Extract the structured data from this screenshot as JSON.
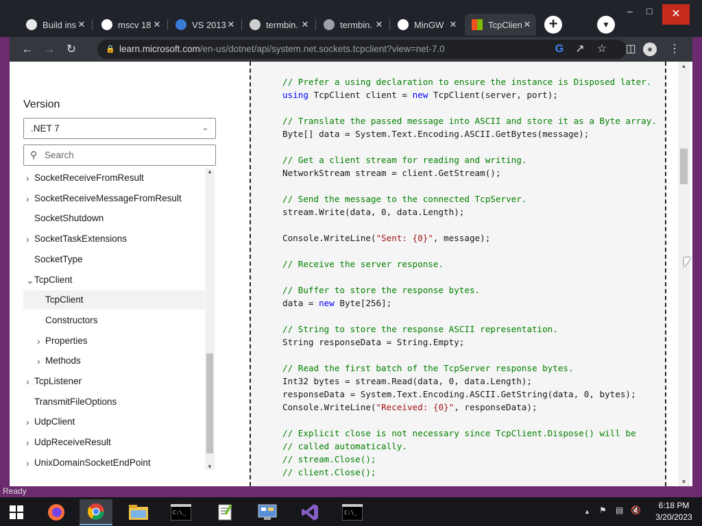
{
  "browser": {
    "tabs": [
      {
        "title": "Build ins",
        "icon": "github-icon"
      },
      {
        "title": "mscv 18",
        "icon": "google-icon"
      },
      {
        "title": "VS 2013",
        "icon": "visual-studio-icon"
      },
      {
        "title": "termbin.",
        "icon": "document-icon"
      },
      {
        "title": "termbin.",
        "icon": "globe-icon"
      },
      {
        "title": "MinGW",
        "icon": "google-icon"
      },
      {
        "title": "TcpClien",
        "icon": "microsoft-icon",
        "active": true
      }
    ],
    "url_host": "learn.microsoft.com",
    "url_path": "/en-us/dotnet/api/system.net.sockets.tcpclient?view=net-7.0"
  },
  "sidebar": {
    "version_label": "Version",
    "version_value": ".NET 7",
    "search_placeholder": "Search",
    "toc": [
      {
        "label": "SocketReceiveFromResult",
        "expandable": true,
        "level": 0
      },
      {
        "label": "SocketReceiveMessageFromResult",
        "expandable": true,
        "level": 0
      },
      {
        "label": "SocketShutdown",
        "expandable": false,
        "level": 0
      },
      {
        "label": "SocketTaskExtensions",
        "expandable": true,
        "level": 0
      },
      {
        "label": "SocketType",
        "expandable": false,
        "level": 0
      },
      {
        "label": "TcpClient",
        "expandable": true,
        "expanded": true,
        "level": 0
      },
      {
        "label": "TcpClient",
        "expandable": false,
        "level": 1,
        "selected": true
      },
      {
        "label": "Constructors",
        "expandable": false,
        "level": 1
      },
      {
        "label": "Properties",
        "expandable": true,
        "level": 1
      },
      {
        "label": "Methods",
        "expandable": true,
        "level": 1
      },
      {
        "label": "TcpListener",
        "expandable": true,
        "level": 0
      },
      {
        "label": "TransmitFileOptions",
        "expandable": false,
        "level": 0
      },
      {
        "label": "UdpClient",
        "expandable": true,
        "level": 0
      },
      {
        "label": "UdpReceiveResult",
        "expandable": true,
        "level": 0
      },
      {
        "label": "UnixDomainSocketEndPoint",
        "expandable": true,
        "level": 0
      }
    ]
  },
  "code": {
    "lines": [
      [
        [
          "c",
          "// Prefer a using declaration to ensure the instance is Disposed later."
        ]
      ],
      [
        [
          "k",
          "using"
        ],
        [
          "t",
          " TcpClient client = "
        ],
        [
          "k",
          "new"
        ],
        [
          "t",
          " TcpClient(server, port);"
        ]
      ],
      [],
      [
        [
          "c",
          "// Translate the passed message into ASCII and store it as a Byte array."
        ]
      ],
      [
        [
          "t",
          "Byte[] data = System.Text.Encoding.ASCII.GetBytes(message);"
        ]
      ],
      [],
      [
        [
          "c",
          "// Get a client stream for reading and writing."
        ]
      ],
      [
        [
          "t",
          "NetworkStream stream = client.GetStream();"
        ]
      ],
      [],
      [
        [
          "c",
          "// Send the message to the connected TcpServer."
        ]
      ],
      [
        [
          "t",
          "stream.Write(data, 0, data.Length);"
        ]
      ],
      [],
      [
        [
          "t",
          "Console.WriteLine("
        ],
        [
          "s",
          "\"Sent: {0}\""
        ],
        [
          "t",
          ", message);"
        ]
      ],
      [],
      [
        [
          "c",
          "// Receive the server response."
        ]
      ],
      [],
      [
        [
          "c",
          "// Buffer to store the response bytes."
        ]
      ],
      [
        [
          "t",
          "data = "
        ],
        [
          "k",
          "new"
        ],
        [
          "t",
          " Byte[256];"
        ]
      ],
      [],
      [
        [
          "c",
          "// String to store the response ASCII representation."
        ]
      ],
      [
        [
          "t",
          "String responseData = String.Empty;"
        ]
      ],
      [],
      [
        [
          "c",
          "// Read the first batch of the TcpServer response bytes."
        ]
      ],
      [
        [
          "t",
          "Int32 bytes = stream.Read(data, 0, data.Length);"
        ]
      ],
      [
        [
          "t",
          "responseData = System.Text.Encoding.ASCII.GetString(data, 0, bytes);"
        ]
      ],
      [
        [
          "t",
          "Console.WriteLine("
        ],
        [
          "s",
          "\"Received: {0}\""
        ],
        [
          "t",
          ", responseData);"
        ]
      ],
      [],
      [
        [
          "c",
          "// Explicit close is not necessary since TcpClient.Dispose() will be"
        ]
      ],
      [
        [
          "c",
          "// called automatically."
        ]
      ],
      [
        [
          "c",
          "// stream.Close();"
        ]
      ],
      [
        [
          "c",
          "// client.Close();"
        ]
      ]
    ]
  },
  "status": {
    "text": "Ready"
  },
  "clock": {
    "time": "6:18 PM",
    "date": "3/20/2023"
  }
}
